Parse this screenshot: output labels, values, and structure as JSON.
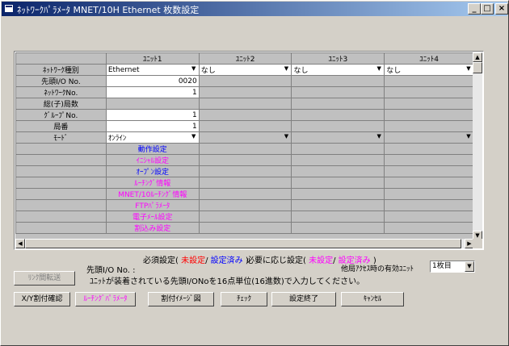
{
  "window": {
    "title": "ﾈｯﾄﾜｰｸﾊﾟﾗﾒｰﾀ MNET/10H Ethernet 枚数設定",
    "min_label": "_",
    "max_label": "□",
    "close_label": "×"
  },
  "grid": {
    "columns": [
      "ﾕﾆｯﾄ1",
      "ﾕﾆｯﾄ2",
      "ﾕﾆｯﾄ3",
      "ﾕﾆｯﾄ4"
    ],
    "rows": {
      "network_type": {
        "label": "ﾈｯﾄﾜｰｸ種別",
        "values": [
          "Ethernet",
          "なし",
          "なし",
          "なし"
        ]
      },
      "start_io": {
        "label": "先頭I/O No.",
        "values": [
          "0020",
          "",
          "",
          ""
        ]
      },
      "network_no": {
        "label": "ﾈｯﾄﾜｰｸNo.",
        "values": [
          "1",
          "",
          "",
          ""
        ]
      },
      "total_stations": {
        "label": "総(子)局数",
        "values": [
          "",
          "",
          "",
          ""
        ]
      },
      "group_no": {
        "label": "ｸﾞﾙｰﾌﾟNo.",
        "values": [
          "1",
          "",
          "",
          ""
        ]
      },
      "station_no": {
        "label": "局番",
        "values": [
          "1",
          "",
          "",
          ""
        ]
      },
      "mode": {
        "label": "ﾓｰﾄﾞ",
        "values": [
          "ｵﾝﾗｲﾝ",
          "",
          "",
          ""
        ]
      }
    },
    "settings": [
      {
        "label": "動作設定",
        "color": "#0000ff"
      },
      {
        "label": "ｲﾆｼｬﾙ設定",
        "color": "#ff00ff"
      },
      {
        "label": "ｵｰﾌﾟﾝ設定",
        "color": "#0000ff"
      },
      {
        "label": "ﾙｰﾁﾝｸﾞ情報",
        "color": "#ff00ff"
      },
      {
        "label": "MNET/10ﾙｰﾁﾝｸﾞ情報",
        "color": "#ff00ff"
      },
      {
        "label": "FTPﾊﾟﾗﾒｰﾀ",
        "color": "#ff00ff"
      },
      {
        "label": "電子ﾒｰﾙ設定",
        "color": "#ff00ff"
      },
      {
        "label": "割込み設定",
        "color": "#ff00ff"
      }
    ]
  },
  "legend": {
    "required": "必須設定(",
    "not_set": "未設定",
    "slash": "/",
    "set_done": "設定済み",
    "close_paren": ")",
    "optional": "必要に応じ設定(",
    "not_set2": "未設定",
    "slash2": "/",
    "set_done2": "設定済み",
    "close_paren2": ")"
  },
  "help": {
    "start_io_label": "先頭I/O No. :",
    "other_station_label": "他局ｱｸｾｽ時の有効ﾕﾆｯﾄ",
    "other_station_value": "1枚目",
    "description": "ﾕﾆｯﾄが装着されている先頭I/ONoを16点単位(16進数)で入力してください。"
  },
  "buttons": {
    "link_transfer": "ﾘﾝｸ間転送",
    "xy_assign": "X/Y割付確認",
    "routing_params": "ﾙｰﾁﾝｸﾞﾊﾟﾗﾒｰﾀ",
    "assign_image": "割付ｲﾒｰｼﾞ図",
    "check": "ﾁｪｯｸ",
    "finish": "設定終了",
    "cancel": "ｷｬﾝｾﾙ"
  },
  "colors": {
    "not_set": "#ff0000",
    "set_done": "#0000ff",
    "routing_text": "#ff00ff"
  }
}
